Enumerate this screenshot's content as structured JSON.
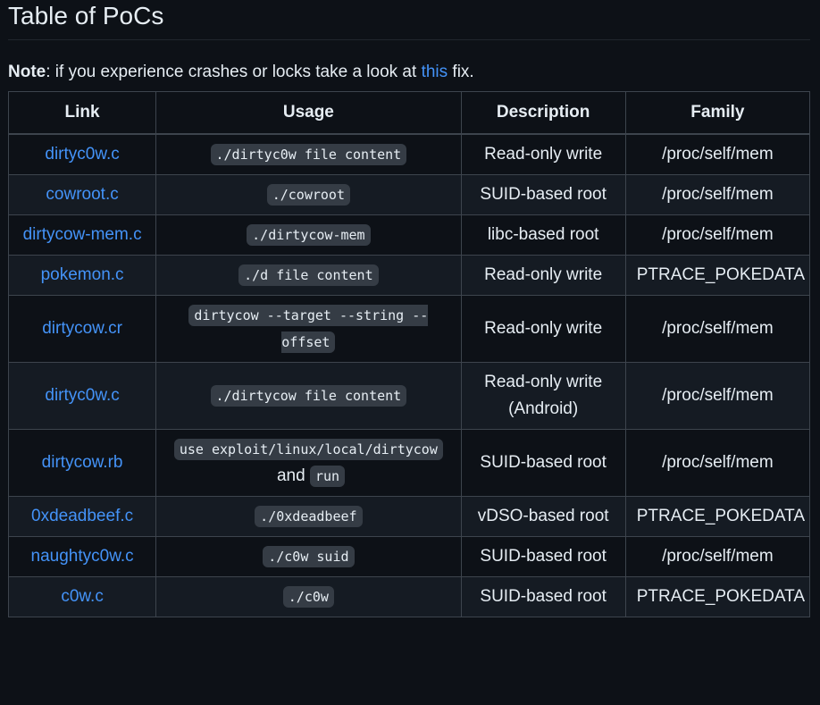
{
  "heading": "Table of PoCs",
  "note": {
    "label": "Note",
    "text_before": ": if you experience crashes or locks take a look at ",
    "link": "this",
    "text_after": " fix."
  },
  "table": {
    "headers": [
      "Link",
      "Usage",
      "Description",
      "Family"
    ],
    "rows": [
      {
        "link": "dirtyc0w.c",
        "usage": "./dirtyc0w file content",
        "usage_suffix": "",
        "description": "Read-only write",
        "family": "/proc/self/mem"
      },
      {
        "link": "cowroot.c",
        "usage": "./cowroot",
        "usage_suffix": "",
        "description": "SUID-based root",
        "family": "/proc/self/mem"
      },
      {
        "link": "dirtycow-mem.c",
        "usage": "./dirtycow-mem",
        "usage_suffix": "",
        "description": "libc-based root",
        "family": "/proc/self/mem"
      },
      {
        "link": "pokemon.c",
        "usage": "./d file content",
        "usage_suffix": "",
        "description": "Read-only write",
        "family": "PTRACE_POKEDATA"
      },
      {
        "link": "dirtycow.cr",
        "usage": "dirtycow --target --string --offset",
        "usage_suffix": "",
        "description": "Read-only write",
        "family": "/proc/self/mem"
      },
      {
        "link": "dirtyc0w.c",
        "usage": "./dirtycow file content",
        "usage_suffix": "",
        "description": "Read-only write (Android)",
        "family": "/proc/self/mem"
      },
      {
        "link": "dirtycow.rb",
        "usage": "use exploit/linux/local/dirtycow",
        "usage_suffix": " and ",
        "usage2": "run",
        "description": "SUID-based root",
        "family": "/proc/self/mem"
      },
      {
        "link": "0xdeadbeef.c",
        "usage": "./0xdeadbeef",
        "usage_suffix": "",
        "description": "vDSO-based root",
        "family": "PTRACE_POKEDATA"
      },
      {
        "link": "naughtyc0w.c",
        "usage": "./c0w suid",
        "usage_suffix": "",
        "description": "SUID-based root",
        "family": "/proc/self/mem"
      },
      {
        "link": "c0w.c",
        "usage": "./c0w",
        "usage_suffix": "",
        "description": "SUID-based root",
        "family": "PTRACE_POKEDATA"
      }
    ]
  },
  "colors": {
    "background": "#0d1117",
    "row_alt": "#151b23",
    "link": "#4493f8",
    "text": "#e6edf3",
    "border": "#3d444d",
    "code_bg": "#353c45"
  }
}
